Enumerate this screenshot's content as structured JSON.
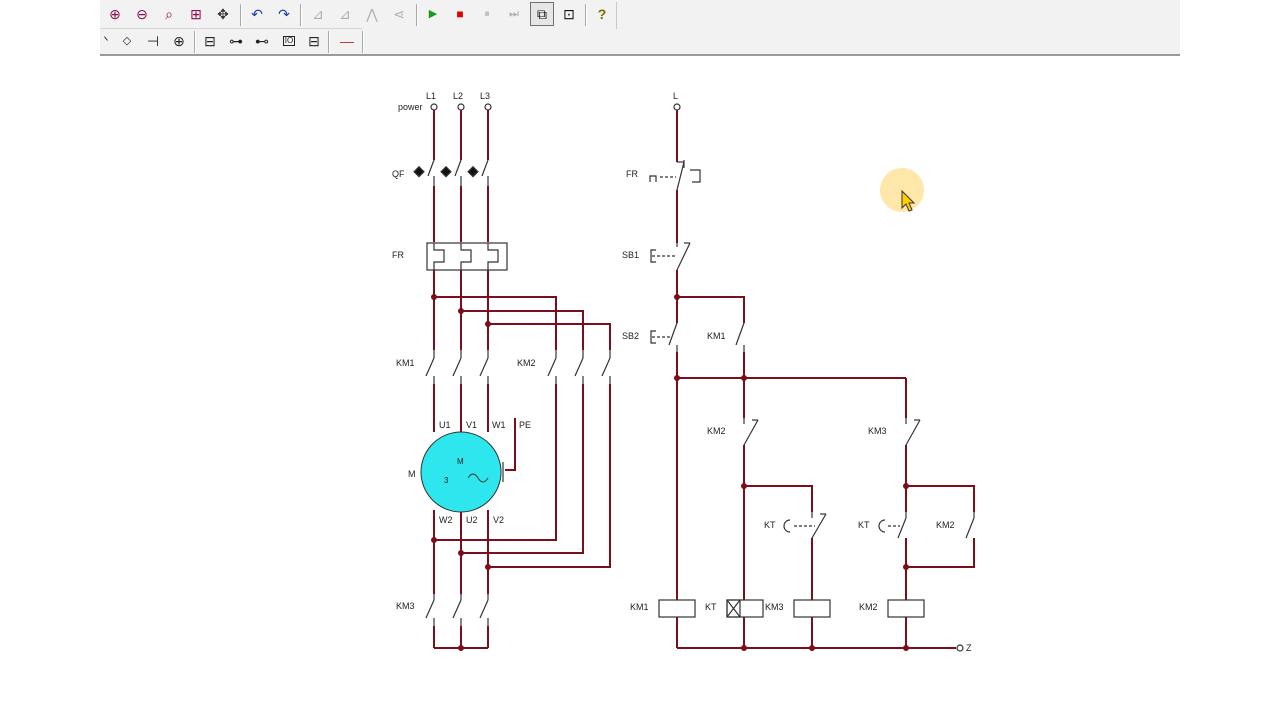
{
  "toolbar": {
    "row1": [
      {
        "name": "zoom-in-icon",
        "glyph": "⊕",
        "color": "#8b0a50"
      },
      {
        "name": "zoom-out-icon",
        "glyph": "⊖",
        "color": "#8b0a50"
      },
      {
        "name": "zoom-window-icon",
        "glyph": "⌕",
        "color": "#8b0a50"
      },
      {
        "name": "zoom-all-icon",
        "glyph": "⊞",
        "color": "#8b0a50"
      },
      {
        "name": "pan-icon",
        "glyph": "✥",
        "color": "#333333"
      },
      {
        "name": "undo-icon",
        "glyph": "↶",
        "color": "#1d3aa8"
      },
      {
        "name": "redo-icon",
        "glyph": "↷",
        "color": "#1d3aa8"
      },
      {
        "name": "align-left-icon",
        "glyph": "⊿",
        "color": "#b0b0b0"
      },
      {
        "name": "align-right-icon",
        "glyph": "⊿",
        "color": "#b0b0b0"
      },
      {
        "name": "align-top-icon",
        "glyph": "⋀",
        "color": "#b0b0b0"
      },
      {
        "name": "align-bottom-icon",
        "glyph": "⋖",
        "color": "#b0b0b0"
      },
      {
        "name": "run-icon",
        "glyph": "▶",
        "color": "#1a9a1a"
      },
      {
        "name": "stop-icon",
        "glyph": "■",
        "color": "#e00000"
      },
      {
        "name": "pause-icon",
        "glyph": "⏸",
        "color": "#b0b0b0"
      },
      {
        "name": "step-icon",
        "glyph": "⏭",
        "color": "#b0b0b0"
      },
      {
        "name": "window-select-icon",
        "glyph": "⧉",
        "color": "#111111"
      },
      {
        "name": "component-browser-icon",
        "glyph": "⊡",
        "color": "#111111"
      },
      {
        "name": "help-icon",
        "glyph": "?",
        "color": "#7a6a00"
      }
    ],
    "row2": [
      {
        "name": "wire-tool-icon",
        "glyph": "ᐠ",
        "color": "#222222"
      },
      {
        "name": "node-tool-icon",
        "glyph": "◇",
        "color": "#222222"
      },
      {
        "name": "contact-no-icon",
        "glyph": "⊣",
        "color": "#222222"
      },
      {
        "name": "contact-nc-icon",
        "glyph": "⊕",
        "color": "#222222"
      },
      {
        "name": "relay-coil-icon",
        "glyph": "⊟",
        "color": "#222222"
      },
      {
        "name": "timer-icon",
        "glyph": "⊶",
        "color": "#222222"
      },
      {
        "name": "thermal-relay-icon",
        "glyph": "⊷",
        "color": "#222222"
      },
      {
        "name": "io-module-icon",
        "glyph": "IO",
        "color": "#222222"
      },
      {
        "name": "terminal-icon",
        "glyph": "⊟",
        "color": "#222222"
      },
      {
        "name": "line-tool-icon",
        "glyph": "—",
        "color": "#b03030"
      }
    ]
  },
  "labels": {
    "L1": "L1",
    "L2": "L2",
    "L3": "L3",
    "power": "power",
    "QF": "QF",
    "FR": "FR",
    "KM1": "KM1",
    "KM2": "KM2",
    "KM3": "KM3",
    "U1": "U1",
    "V1": "V1",
    "W1": "W1",
    "PE": "PE",
    "M": "M",
    "motor_M": "M",
    "motor_3": "3",
    "W2": "W2",
    "U2": "U2",
    "V2": "V2",
    "L": "L",
    "SB1": "SB1",
    "SB2": "SB2",
    "KT": "KT",
    "N": "Z"
  },
  "colors": {
    "wire": "#7a0e1a",
    "motor": "#2ee6ee",
    "symbol": "#333333",
    "toolbar": "#f2f2f2"
  }
}
